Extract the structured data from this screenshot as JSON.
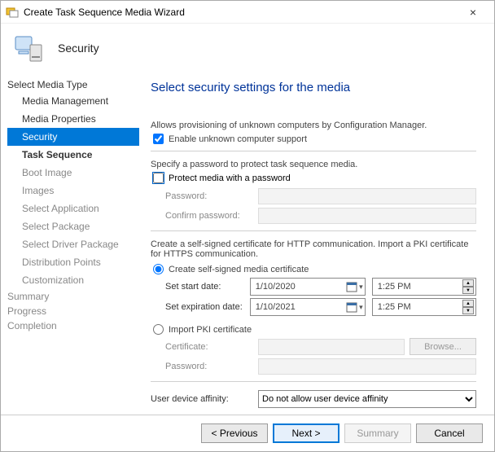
{
  "window": {
    "title": "Create Task Sequence Media Wizard"
  },
  "header": {
    "label": "Security"
  },
  "sidebar": {
    "group_top": "Select Media Type",
    "items": [
      {
        "label": "Media Management",
        "state": "done"
      },
      {
        "label": "Media Properties",
        "state": "done"
      },
      {
        "label": "Security",
        "state": "selected"
      },
      {
        "label": "Task Sequence",
        "state": "next"
      },
      {
        "label": "Boot Image",
        "state": "disabled"
      },
      {
        "label": "Images",
        "state": "disabled"
      },
      {
        "label": "Select Application",
        "state": "disabled"
      },
      {
        "label": "Select Package",
        "state": "disabled"
      },
      {
        "label": "Select Driver Package",
        "state": "disabled"
      },
      {
        "label": "Distribution Points",
        "state": "disabled"
      },
      {
        "label": "Customization",
        "state": "disabled"
      }
    ],
    "group_bottom": [
      "Summary",
      "Progress",
      "Completion"
    ]
  },
  "main": {
    "heading": "Select security settings for the media",
    "unknown_text": "Allows provisioning of unknown computers by Configuration Manager.",
    "unknown_checkbox": "Enable unknown computer support",
    "unknown_checked": true,
    "pw_text": "Specify a password to protect task sequence media.",
    "pw_checkbox": "Protect media with a password",
    "pw_checked": false,
    "pw_label": "Password:",
    "pw_confirm_label": "Confirm password:",
    "cert_text": "Create a self-signed certificate for HTTP communication. Import a PKI certificate for HTTPS communication.",
    "cert_radio_self": "Create self-signed media certificate",
    "cert_radio_import": "Import PKI certificate",
    "cert_selected": "self",
    "start_label": "Set start date:",
    "start_date": "1/10/2020",
    "start_time": "1:25 PM",
    "exp_label": "Set expiration date:",
    "exp_date": "1/10/2021",
    "exp_time": "1:25 PM",
    "import_cert_label": "Certificate:",
    "import_pw_label": "Password:",
    "browse_label": "Browse...",
    "uda_label": "User device affinity:",
    "uda_value": "Do not allow user device affinity"
  },
  "footer": {
    "previous": "< Previous",
    "next": "Next >",
    "summary": "Summary",
    "cancel": "Cancel"
  }
}
